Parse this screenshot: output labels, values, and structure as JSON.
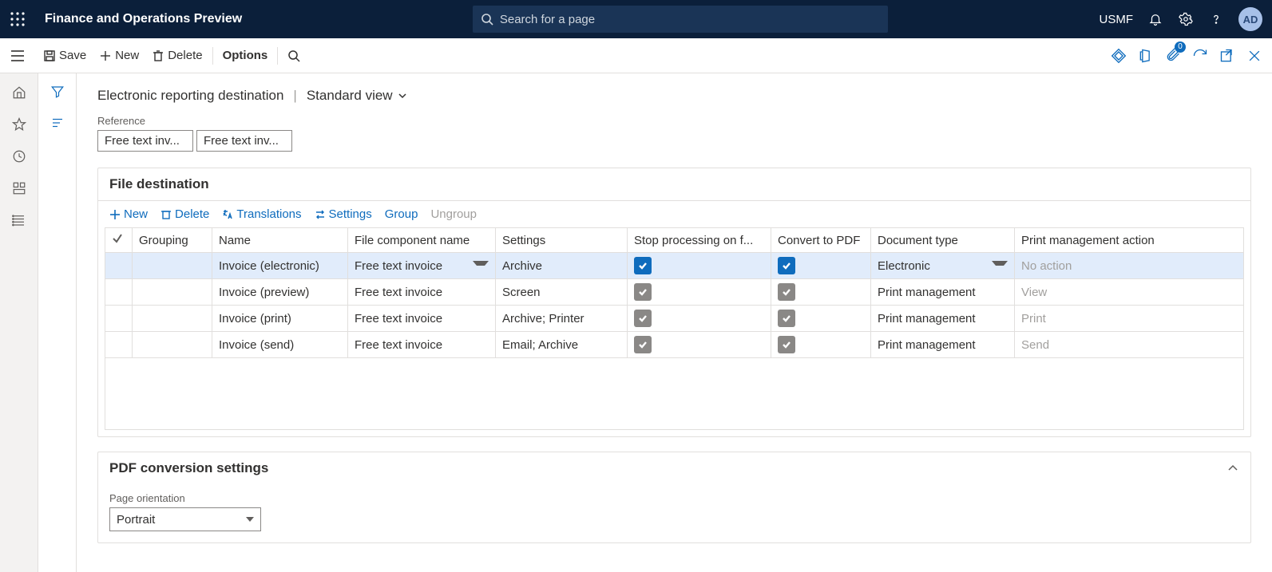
{
  "header": {
    "app_title": "Finance and Operations Preview",
    "search_placeholder": "Search for a page",
    "company": "USMF",
    "avatar": "AD"
  },
  "actionbar": {
    "save": "Save",
    "new": "New",
    "delete": "Delete",
    "options": "Options",
    "attach_badge": "0"
  },
  "breadcrumb": {
    "title": "Electronic reporting destination",
    "view": "Standard view"
  },
  "reference": {
    "label": "Reference",
    "val1": "Free text inv...",
    "val2": "Free text inv..."
  },
  "file_destination": {
    "title": "File destination",
    "toolbar": {
      "new": "New",
      "delete": "Delete",
      "translations": "Translations",
      "settings": "Settings",
      "group": "Group",
      "ungroup": "Ungroup"
    },
    "columns": {
      "grouping": "Grouping",
      "name": "Name",
      "file_component": "File component name",
      "settings": "Settings",
      "stop": "Stop processing on f...",
      "convert": "Convert to PDF",
      "doc_type": "Document type",
      "pm_action": "Print management action"
    },
    "rows": [
      {
        "name": "Invoice (electronic)",
        "file": "Free text invoice",
        "settings": "Archive",
        "stop": true,
        "convert": true,
        "doc_type": "Electronic",
        "pm_action": "No action",
        "selected": true,
        "stop_blue": true,
        "convert_blue": true,
        "muted_action": true,
        "dd_file": true,
        "dd_doc": true
      },
      {
        "name": "Invoice (preview)",
        "file": "Free text invoice",
        "settings": "Screen",
        "stop": true,
        "convert": true,
        "doc_type": "Print management",
        "pm_action": "View",
        "muted_action": true
      },
      {
        "name": "Invoice (print)",
        "file": "Free text invoice",
        "settings": "Archive; Printer",
        "stop": true,
        "convert": true,
        "doc_type": "Print management",
        "pm_action": "Print",
        "muted_action": true
      },
      {
        "name": "Invoice (send)",
        "file": "Free text invoice",
        "settings": "Email; Archive",
        "stop": true,
        "convert": true,
        "doc_type": "Print management",
        "pm_action": "Send",
        "muted_action": true
      }
    ]
  },
  "pdf": {
    "title": "PDF conversion settings",
    "orientation_label": "Page orientation",
    "orientation_value": "Portrait"
  }
}
